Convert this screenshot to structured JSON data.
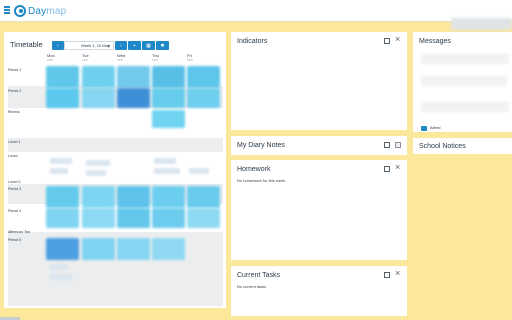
{
  "app": {
    "logo_primary": "Day",
    "logo_secondary": "map",
    "accent": "#1e88c8"
  },
  "timetable": {
    "title": "Timetable",
    "week_label": "Week 1, 10 May",
    "prev_icon": "chevron-left-icon",
    "next_icon": "chevron-right-icon",
    "days": [
      {
        "name": "Mon",
        "date": "10/5"
      },
      {
        "name": "Tue",
        "date": "11/5"
      },
      {
        "name": "Wed",
        "date": "12/5"
      },
      {
        "name": "Thu",
        "date": "13/5"
      },
      {
        "name": "Fri",
        "date": "14/5"
      }
    ],
    "periods": [
      "Period 1",
      "Period 2",
      "Recess",
      "Lunch 1",
      "Lunch",
      "Lunch 2",
      "Period 3",
      "Period 4",
      "Afternoon Tea",
      "Period 5"
    ]
  },
  "indicators": {
    "title": "Indicators"
  },
  "diary": {
    "title": "My Diary Notes"
  },
  "homework": {
    "title": "Homework",
    "empty": "No homework for this week"
  },
  "tasks": {
    "title": "Current Tasks",
    "empty": "No current tasks"
  },
  "messages": {
    "title": "Messages",
    "item_label": "Alfred"
  },
  "school_notices": {
    "title": "School Notices"
  }
}
